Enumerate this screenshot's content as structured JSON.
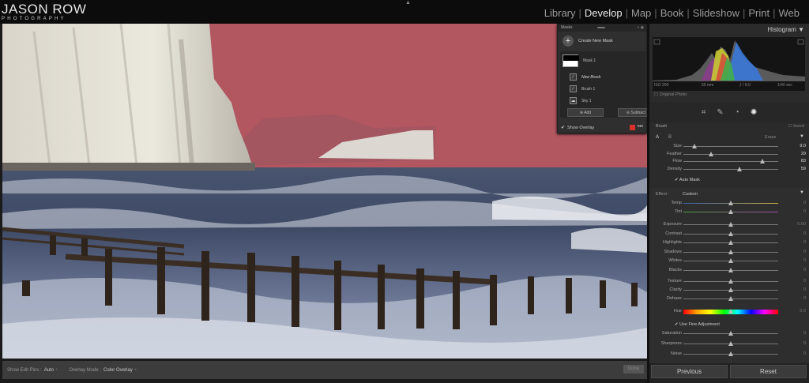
{
  "branding": {
    "line1": "JASON ROW",
    "line2": "PHOTOGRAPHY"
  },
  "modules": [
    {
      "label": "Library",
      "active": false
    },
    {
      "label": "Develop",
      "active": true
    },
    {
      "label": "Map",
      "active": false
    },
    {
      "label": "Book",
      "active": false
    },
    {
      "label": "Slideshow",
      "active": false
    },
    {
      "label": "Print",
      "active": false
    },
    {
      "label": "Web",
      "active": false
    }
  ],
  "masks_panel": {
    "title": "Masks",
    "create_label": "Create New Mask",
    "mask_name": "Mask 1",
    "new_brush_label": "New Brush",
    "brush_label": "Brush 1",
    "sky_label": "Sky 1",
    "add_label": "Add",
    "subtract_label": "Subtract",
    "show_overlay_label": "Show Overlay",
    "overlay_color": "#d8302a"
  },
  "toolbar": {
    "show_edit_pins_label": "Show Edit Pins :",
    "show_edit_pins_value": "Auto",
    "overlay_mode_label": "Overlay Mode :",
    "overlay_mode_value": "Color Overlay",
    "done_label": "Done"
  },
  "histogram": {
    "title": "Histogram",
    "iso": "ISO 200",
    "focal": "55 mm",
    "aperture": "ƒ / 8.0",
    "shutter": "1/40 sec",
    "original_photo_label": "Original Photo"
  },
  "brush": {
    "title": "Brush",
    "invert_label": "Invert",
    "tab_a": "A",
    "tab_b": "B",
    "tab_erase": "Erase",
    "sliders": [
      {
        "label": "Size",
        "value": "9.0",
        "pos": 0.12
      },
      {
        "label": "Feather",
        "value": "29",
        "pos": 0.29
      },
      {
        "label": "Flow",
        "value": "83",
        "pos": 0.83
      },
      {
        "label": "Density",
        "value": "59",
        "pos": 0.59
      }
    ],
    "auto_mask_label": "Auto Mask"
  },
  "effect": {
    "label": "Effect :",
    "value": "Custom",
    "sliders_a": [
      {
        "label": "Temp",
        "value": "0",
        "pos": 0.5
      },
      {
        "label": "Tint",
        "value": "0",
        "pos": 0.5
      }
    ],
    "sliders_b": [
      {
        "label": "Exposure",
        "value": "0.00",
        "pos": 0.5
      },
      {
        "label": "Contrast",
        "value": "0",
        "pos": 0.5
      },
      {
        "label": "Highlights",
        "value": "0",
        "pos": 0.5
      },
      {
        "label": "Shadows",
        "value": "0",
        "pos": 0.5
      },
      {
        "label": "Whites",
        "value": "0",
        "pos": 0.5
      },
      {
        "label": "Blacks",
        "value": "0",
        "pos": 0.5
      }
    ],
    "sliders_c": [
      {
        "label": "Texture",
        "value": "0",
        "pos": 0.5
      },
      {
        "label": "Clarity",
        "value": "0",
        "pos": 0.5
      },
      {
        "label": "Dehaze",
        "value": "0",
        "pos": 0.5
      }
    ],
    "hue": {
      "label": "Hue",
      "value": "0.0",
      "pos": 0.5
    },
    "fine_adjust_label": "Use Fine Adjustment",
    "sliders_d": [
      {
        "label": "Saturation",
        "value": "0",
        "pos": 0.5
      },
      {
        "label": "Sharpness",
        "value": "0",
        "pos": 0.5
      },
      {
        "label": "Noise",
        "value": "0",
        "pos": 0.5
      }
    ]
  },
  "buttons": {
    "previous": "Previous",
    "reset": "Reset"
  }
}
